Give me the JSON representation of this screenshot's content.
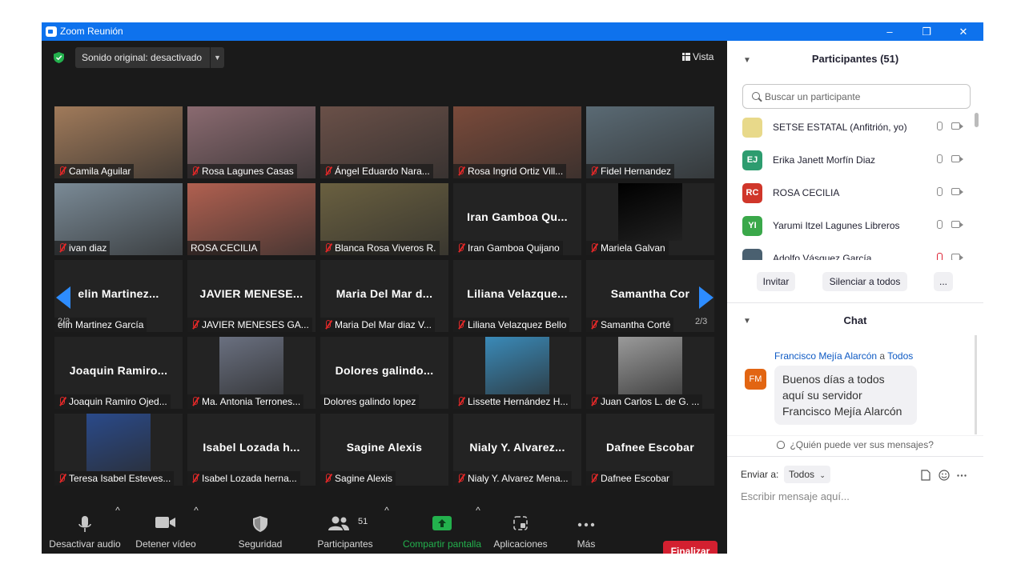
{
  "window": {
    "title": "Zoom Reunión",
    "min": "–",
    "max": "❐",
    "close": "✕"
  },
  "top": {
    "sound": "Sonido original: desactivado",
    "view": "Vista"
  },
  "pages": {
    "left": "2/3",
    "right": "2/3"
  },
  "tiles": [
    {
      "name": "Camila Aguilar",
      "video": true,
      "color": "#a07a5a"
    },
    {
      "name": "Rosa Lagunes Casas",
      "video": true,
      "color": "#8a6a70"
    },
    {
      "name": "Ángel Eduardo Nara...",
      "video": true,
      "color": "#6a5048"
    },
    {
      "name": "Rosa Ingrid Ortiz Vill...",
      "video": true,
      "color": "#7a4a3a"
    },
    {
      "name": "Fidel Hernandez",
      "video": true,
      "color": "#5a6a74"
    },
    {
      "name": "ivan diaz",
      "video": true,
      "color": "#7a8a96"
    },
    {
      "name": "ROSA CECILIA",
      "video": true,
      "color": "#b06050",
      "nomic": true
    },
    {
      "name": "Blanca Rosa Viveros R.",
      "video": true,
      "color": "#6a6040"
    },
    {
      "name": "Iran Gamboa Quijano",
      "big": "Iran Gamboa Qu..."
    },
    {
      "name": "Mariela Galvan",
      "video": true,
      "color": "#000000",
      "narrow": true
    },
    {
      "name": "elin Martinez García",
      "big": "elin Martinez...",
      "nomic": true
    },
    {
      "name": "JAVIER MENESES GA...",
      "big": "JAVIER MENESE..."
    },
    {
      "name": "Maria Del Mar diaz V...",
      "big": "Maria Del Mar d..."
    },
    {
      "name": "Liliana Velazquez Bello",
      "big": "Liliana Velazque..."
    },
    {
      "name": "Samantha Corté",
      "big": "Samantha Cor"
    },
    {
      "name": "Joaquin Ramiro Ojed...",
      "big": "Joaquin Ramiro..."
    },
    {
      "name": "Ma. Antonia Terrones...",
      "video": true,
      "color": "#6a7080",
      "narrow": true
    },
    {
      "name": "Dolores galindo lopez",
      "big": "Dolores galindo...",
      "nomic": true
    },
    {
      "name": "Lissette Hernández H...",
      "video": true,
      "color": "#3a8ab8",
      "narrow": true
    },
    {
      "name": "Juan Carlos L. de G. ...",
      "video": true,
      "color": "#9a9a9a",
      "narrow": true
    },
    {
      "name": "Teresa Isabel Esteves...",
      "video": true,
      "color": "#2a4a8a",
      "narrow": true
    },
    {
      "name": "Isabel Lozada herna...",
      "big": "Isabel Lozada h..."
    },
    {
      "name": "Sagine Alexis",
      "big": "Sagine Alexis"
    },
    {
      "name": "Nialy Y. Alvarez Mena...",
      "big": "Nialy Y. Alvarez..."
    },
    {
      "name": "Dafnee Escobar",
      "big": "Dafnee Escobar"
    }
  ],
  "toolbar": {
    "audio": "Desactivar audio",
    "video": "Detener vídeo",
    "security": "Seguridad",
    "participants": "Participantes",
    "participants_count": "51",
    "share": "Compartir pantalla",
    "apps": "Aplicaciones",
    "more": "Más",
    "end": "Finalizar"
  },
  "panel": {
    "title": "Participantes (51)",
    "search_placeholder": "Buscar un participante",
    "participants": [
      {
        "initials": "",
        "name": "SETSE ESTATAL (Anfitrión, yo)",
        "color": "#e8d98a"
      },
      {
        "initials": "EJ",
        "name": "Erika Janett Morfín Diaz",
        "color": "#2d9c6f"
      },
      {
        "initials": "RC",
        "name": "ROSA CECILIA",
        "color": "#d0362a"
      },
      {
        "initials": "YI",
        "name": "Yarumi Itzel Lagunes Libreros",
        "color": "#3aa84a"
      },
      {
        "initials": "",
        "name": "Adolfo Vásquez García",
        "color": "#4a6070"
      }
    ],
    "invite": "Invitar",
    "mute_all": "Silenciar a todos",
    "more": "...",
    "chat_title": "Chat",
    "chat_from": "Francisco Mejía Alarcón",
    "chat_a": "a",
    "chat_to": "Todos",
    "chat_initials": "FM",
    "chat_lines": [
      "Buenos días a todos",
      "aquí su servidor",
      "Francisco Mejía Alarcón"
    ],
    "who_can_see": "¿Quién puede ver sus mensajes?",
    "send_to_label": "Enviar a:",
    "send_to_value": "Todos",
    "input_placeholder": "Escribir mensaje aquí..."
  }
}
